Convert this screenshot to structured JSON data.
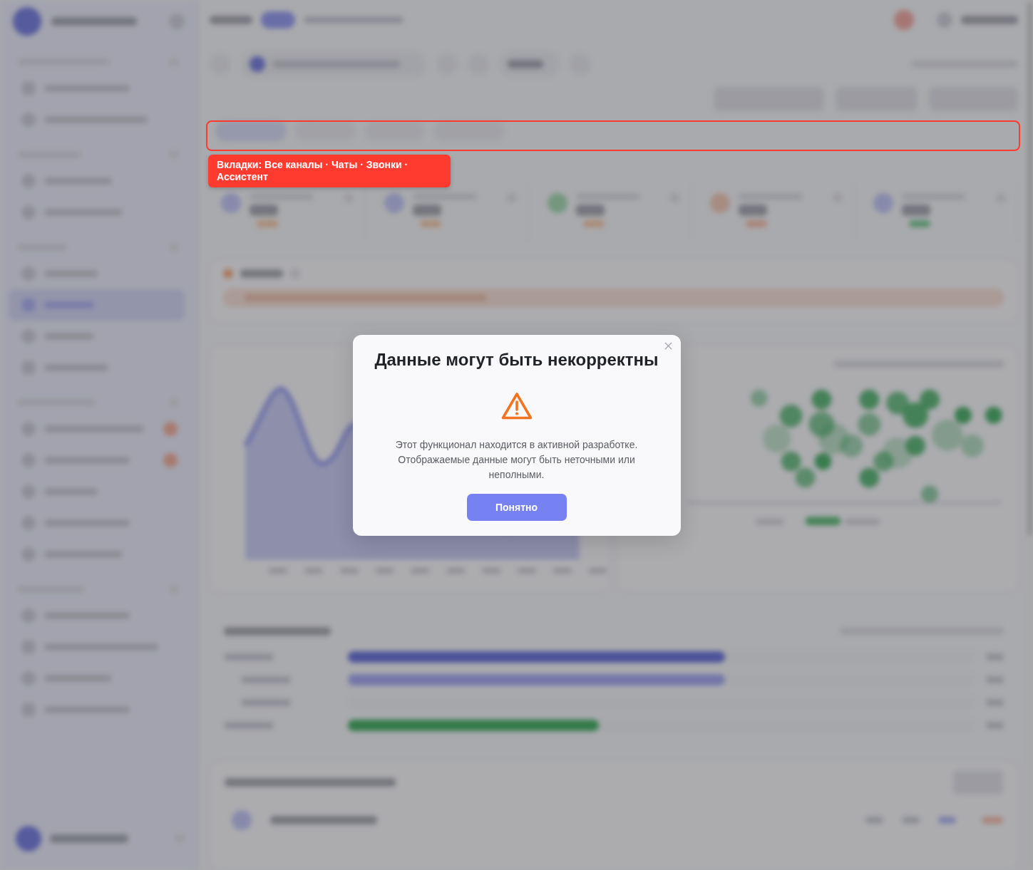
{
  "annotation": {
    "text": "Вкладки: Все каналы · Чаты · Звонки · Ассистент"
  },
  "dialog": {
    "title": "Данные могут быть некорректны",
    "message": "Этот функционал находится в активной разработке. Отображаемые данные могут быть неточными или неполными.",
    "button": "Понятно"
  }
}
